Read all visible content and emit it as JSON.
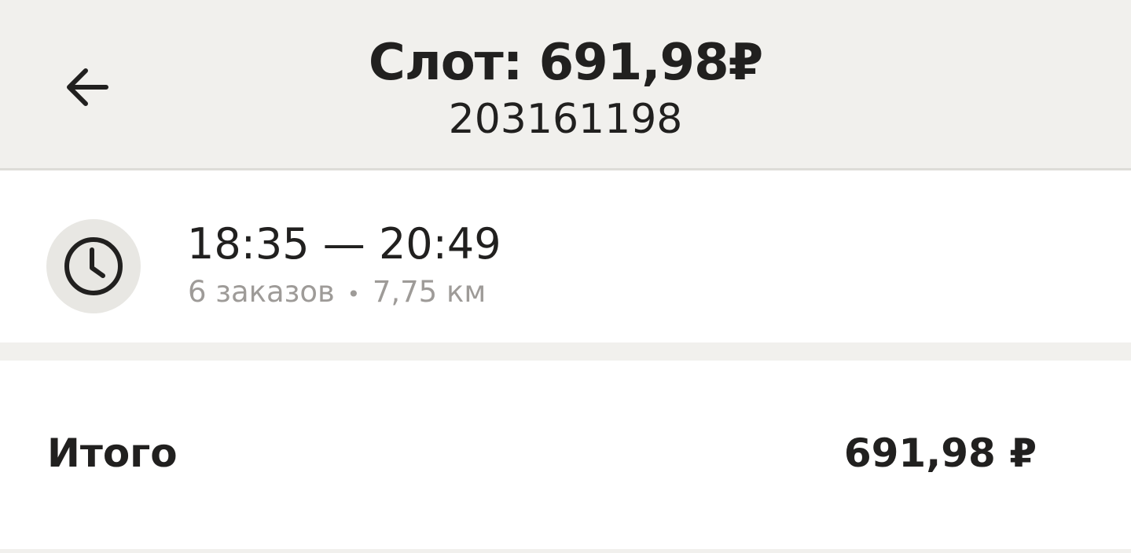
{
  "header": {
    "back_icon": "arrow-left-icon",
    "title": "Слот: 691,98₽",
    "subtitle": "203161198"
  },
  "slot": {
    "icon": "clock-icon",
    "time_range": "18:35 — 20:49",
    "orders": "6 заказов",
    "separator": "•",
    "distance": "7,75 км"
  },
  "summary": {
    "total_label": "Итого",
    "total_value": "691,98 ₽"
  },
  "colors": {
    "header_background": "#f1f0ed",
    "card_background": "#ffffff",
    "primary_text": "#21201f",
    "secondary_text": "#9e9b98",
    "icon_circle": "#e8e7e3"
  }
}
